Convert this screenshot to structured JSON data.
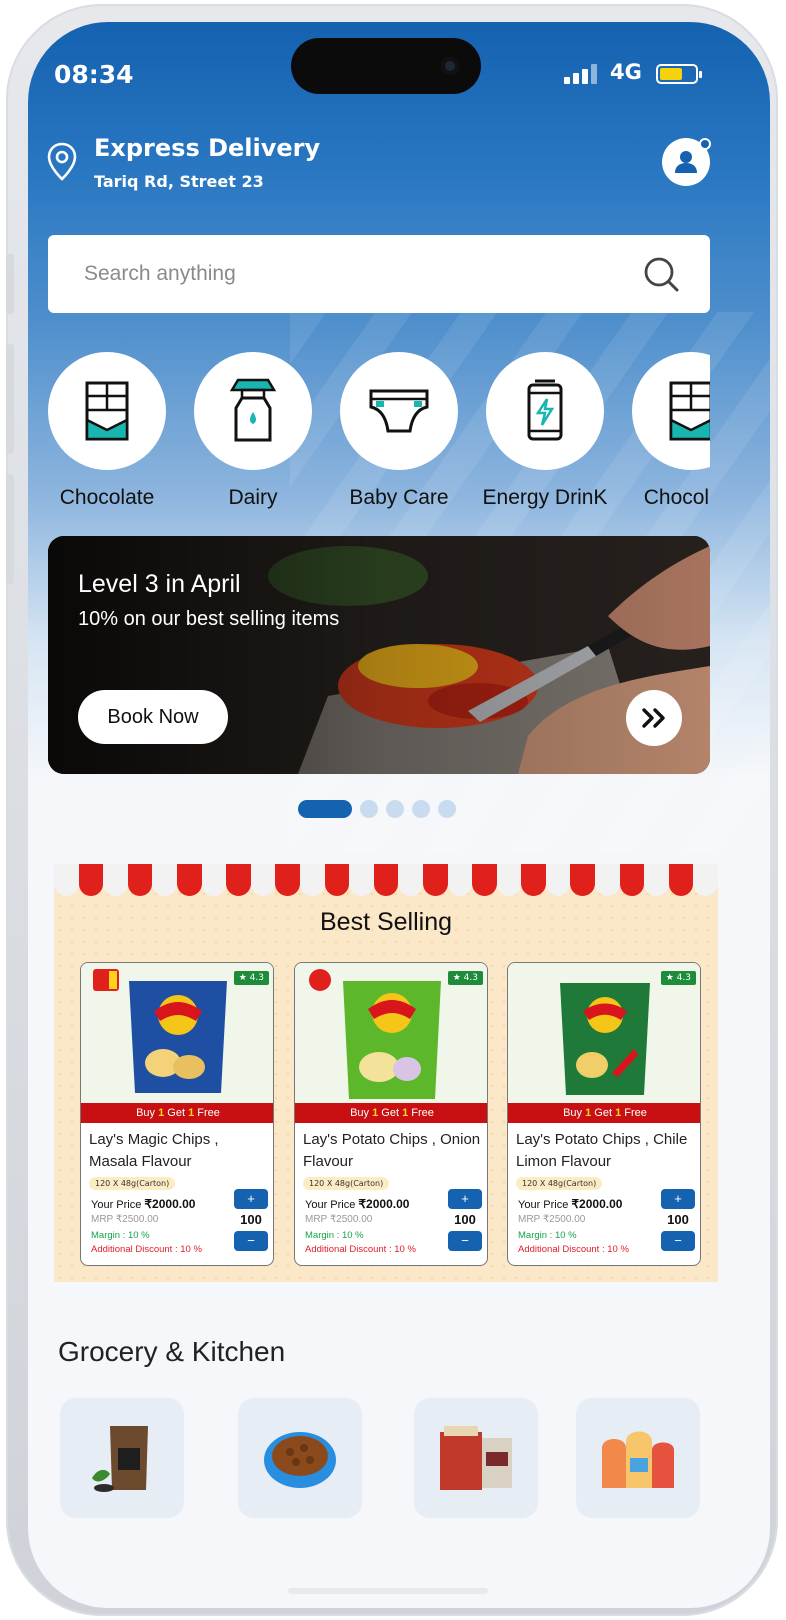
{
  "status_bar": {
    "time": "08:34",
    "network": "4G"
  },
  "header": {
    "delivery_title": "Express Delivery",
    "address": "Tariq Rd, Street 23",
    "accent_color": "#1462b0"
  },
  "search": {
    "placeholder": "Search anything"
  },
  "categories": [
    {
      "label": "Chocolate",
      "icon": "chocolate-bar-icon"
    },
    {
      "label": "Dairy",
      "icon": "milk-bottle-icon"
    },
    {
      "label": "Baby Care",
      "icon": "diaper-icon"
    },
    {
      "label": "Energy DrinK",
      "icon": "energy-can-icon"
    },
    {
      "label": "Chocolate",
      "icon": "chocolate-bar-icon"
    }
  ],
  "banner": {
    "title": "Level 3 in April",
    "subtitle": "10% on our best selling items",
    "button_label": "Book Now",
    "carousel_pages": 5,
    "active_page": 1
  },
  "best_selling": {
    "title": "Best Selling",
    "products": [
      {
        "name": "Lay's Magic Chips , Masala Flavour",
        "rating": "★ 4.3",
        "promo_pre": "Buy ",
        "promo_n1": "1",
        "promo_mid": " Get ",
        "promo_n2": "1",
        "promo_post": " Free",
        "pack": "120 X 48g(Carton)",
        "price_label": "Your Price ",
        "price": "₹2000.00",
        "mrp": "MRP ₹2500.00",
        "margin": "Margin : 10 %",
        "discount": "Additional Discount : 10 %",
        "qty": "100",
        "plus": "+",
        "minus": "−",
        "bag_color": "#1f4fa3"
      },
      {
        "name": "Lay's Potato Chips , Onion Flavour",
        "rating": "★ 4.3",
        "promo_pre": "Buy ",
        "promo_n1": "1",
        "promo_mid": " Get ",
        "promo_n2": "1",
        "promo_post": " Free",
        "pack": "120 X 48g(Carton)",
        "price_label": "Your Price ",
        "price": "₹2000.00",
        "mrp": "MRP ₹2500.00",
        "margin": "Margin : 10 %",
        "discount": "Additional Discount : 10 %",
        "qty": "100",
        "plus": "+",
        "minus": "−",
        "bag_color": "#5cb82a"
      },
      {
        "name": "Lay's Potato Chips , Chile Limon Flavour",
        "rating": "★ 4.3",
        "promo_pre": "Buy ",
        "promo_n1": "1",
        "promo_mid": " Get ",
        "promo_n2": "1",
        "promo_post": " Free",
        "pack": "120 X 48g(Carton)",
        "price_label": "Your Price ",
        "price": "₹2000.00",
        "mrp": "MRP ₹2500.00",
        "margin": "Margin : 10 %",
        "discount": "Additional Discount : 10 %",
        "qty": "100",
        "plus": "+",
        "minus": "−",
        "bag_color": "#1f7a3a"
      }
    ]
  },
  "grocery": {
    "title": "Grocery & Kitchen",
    "tiles": [
      {
        "icon": "tea-pack-icon"
      },
      {
        "icon": "pet-food-bowl-icon"
      },
      {
        "icon": "flour-bags-icon"
      },
      {
        "icon": "bread-loaves-icon"
      }
    ]
  }
}
